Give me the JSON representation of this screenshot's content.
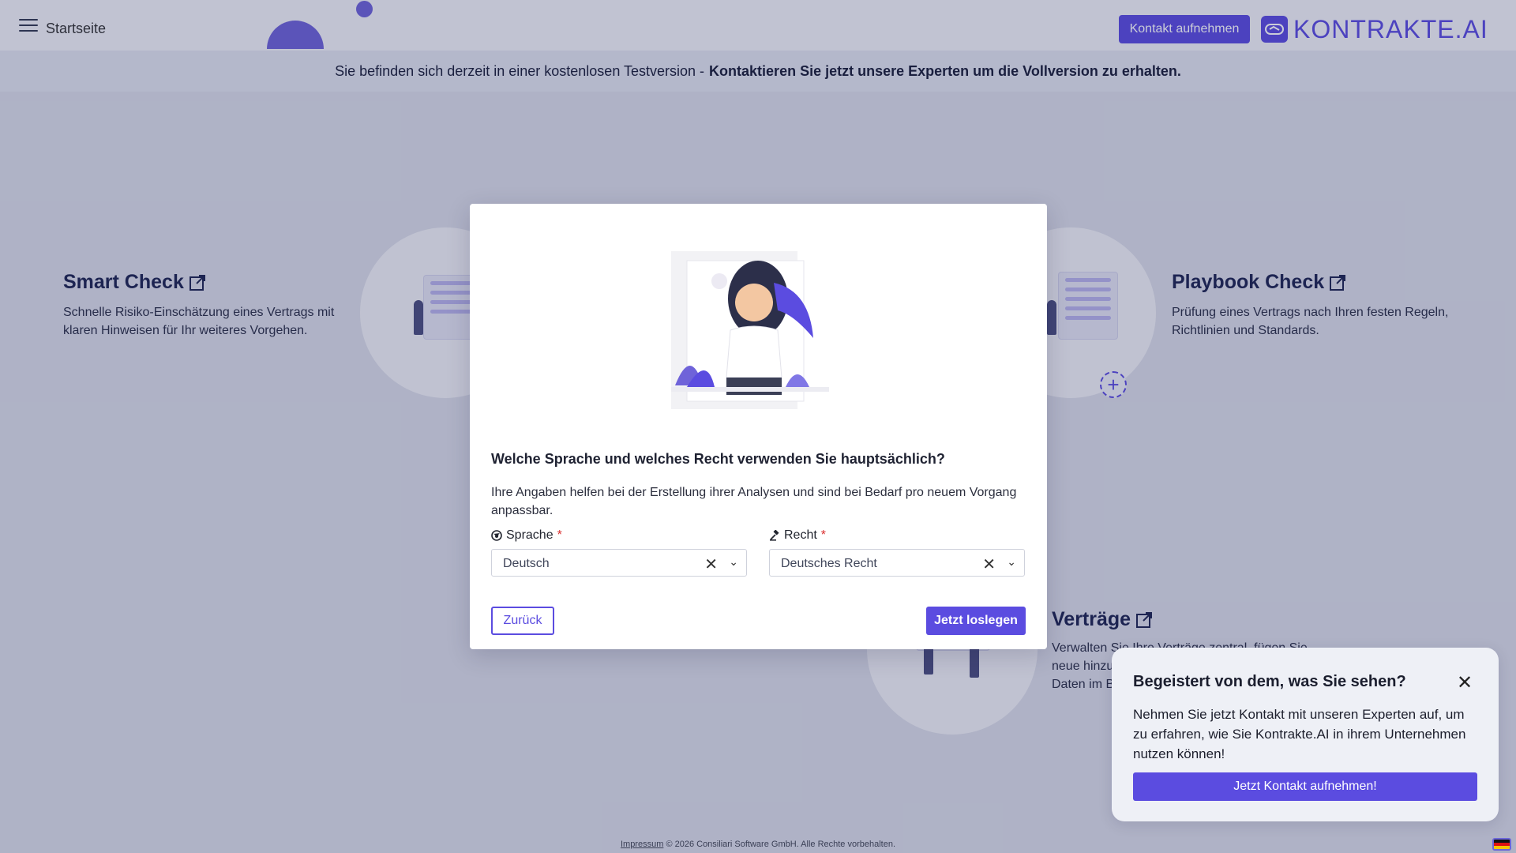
{
  "header": {
    "title": "Startseite",
    "contact_button": "Kontakt aufnehmen",
    "logo_text": "KONTRAKTE.AI"
  },
  "banner": {
    "text": "Sie befinden sich derzeit in einer kostenlosen Testversion -",
    "cta": "Kontaktieren Sie jetzt unsere Experten um die Vollversion zu erhalten."
  },
  "features": [
    {
      "title": "Smart Check",
      "description": "Schnelle Risiko-Einschätzung eines Vertrags mit klaren Hinweisen für Ihr weiteres Vorgehen."
    },
    {
      "title": "Playbook Check",
      "description": "Prüfung eines Vertrags nach Ihren festen Regeln, Richtlinien und Standards."
    },
    {
      "title": "Verträge",
      "description": "Verwalten Sie Ihre Verträge zentral, fügen Sie neue hinzu und behalten Sie alle wichtigen Daten im Blick."
    }
  ],
  "modal": {
    "question": "Welche Sprache und welches Recht verwenden Sie hauptsächlich?",
    "help": "Ihre Angaben helfen bei der Erstellung ihrer Analysen und sind bei Bedarf pro neuem Vorgang anpassbar.",
    "language_label": "Sprache",
    "language_value": "Deutsch",
    "law_label": "Recht",
    "law_value": "Deutsches Recht",
    "required_mark": "*",
    "back_button": "Zurück",
    "start_button": "Jetzt loslegen"
  },
  "toast": {
    "title": "Begeistert von dem, was Sie sehen?",
    "text": "Nehmen Sie jetzt Kontakt mit unseren Experten auf, um zu erfahren, wie Sie Kontrakte.AI in ihrem Unternehmen nutzen können!",
    "button": "Jetzt Kontakt aufnehmen!"
  },
  "footer": {
    "impressum": "Impressum",
    "copyright": "© 2026 Consiliari Software GmbH. Alle Rechte vorbehalten."
  },
  "colors": {
    "accent": "#5b4ce0",
    "required": "#d92b2b"
  }
}
